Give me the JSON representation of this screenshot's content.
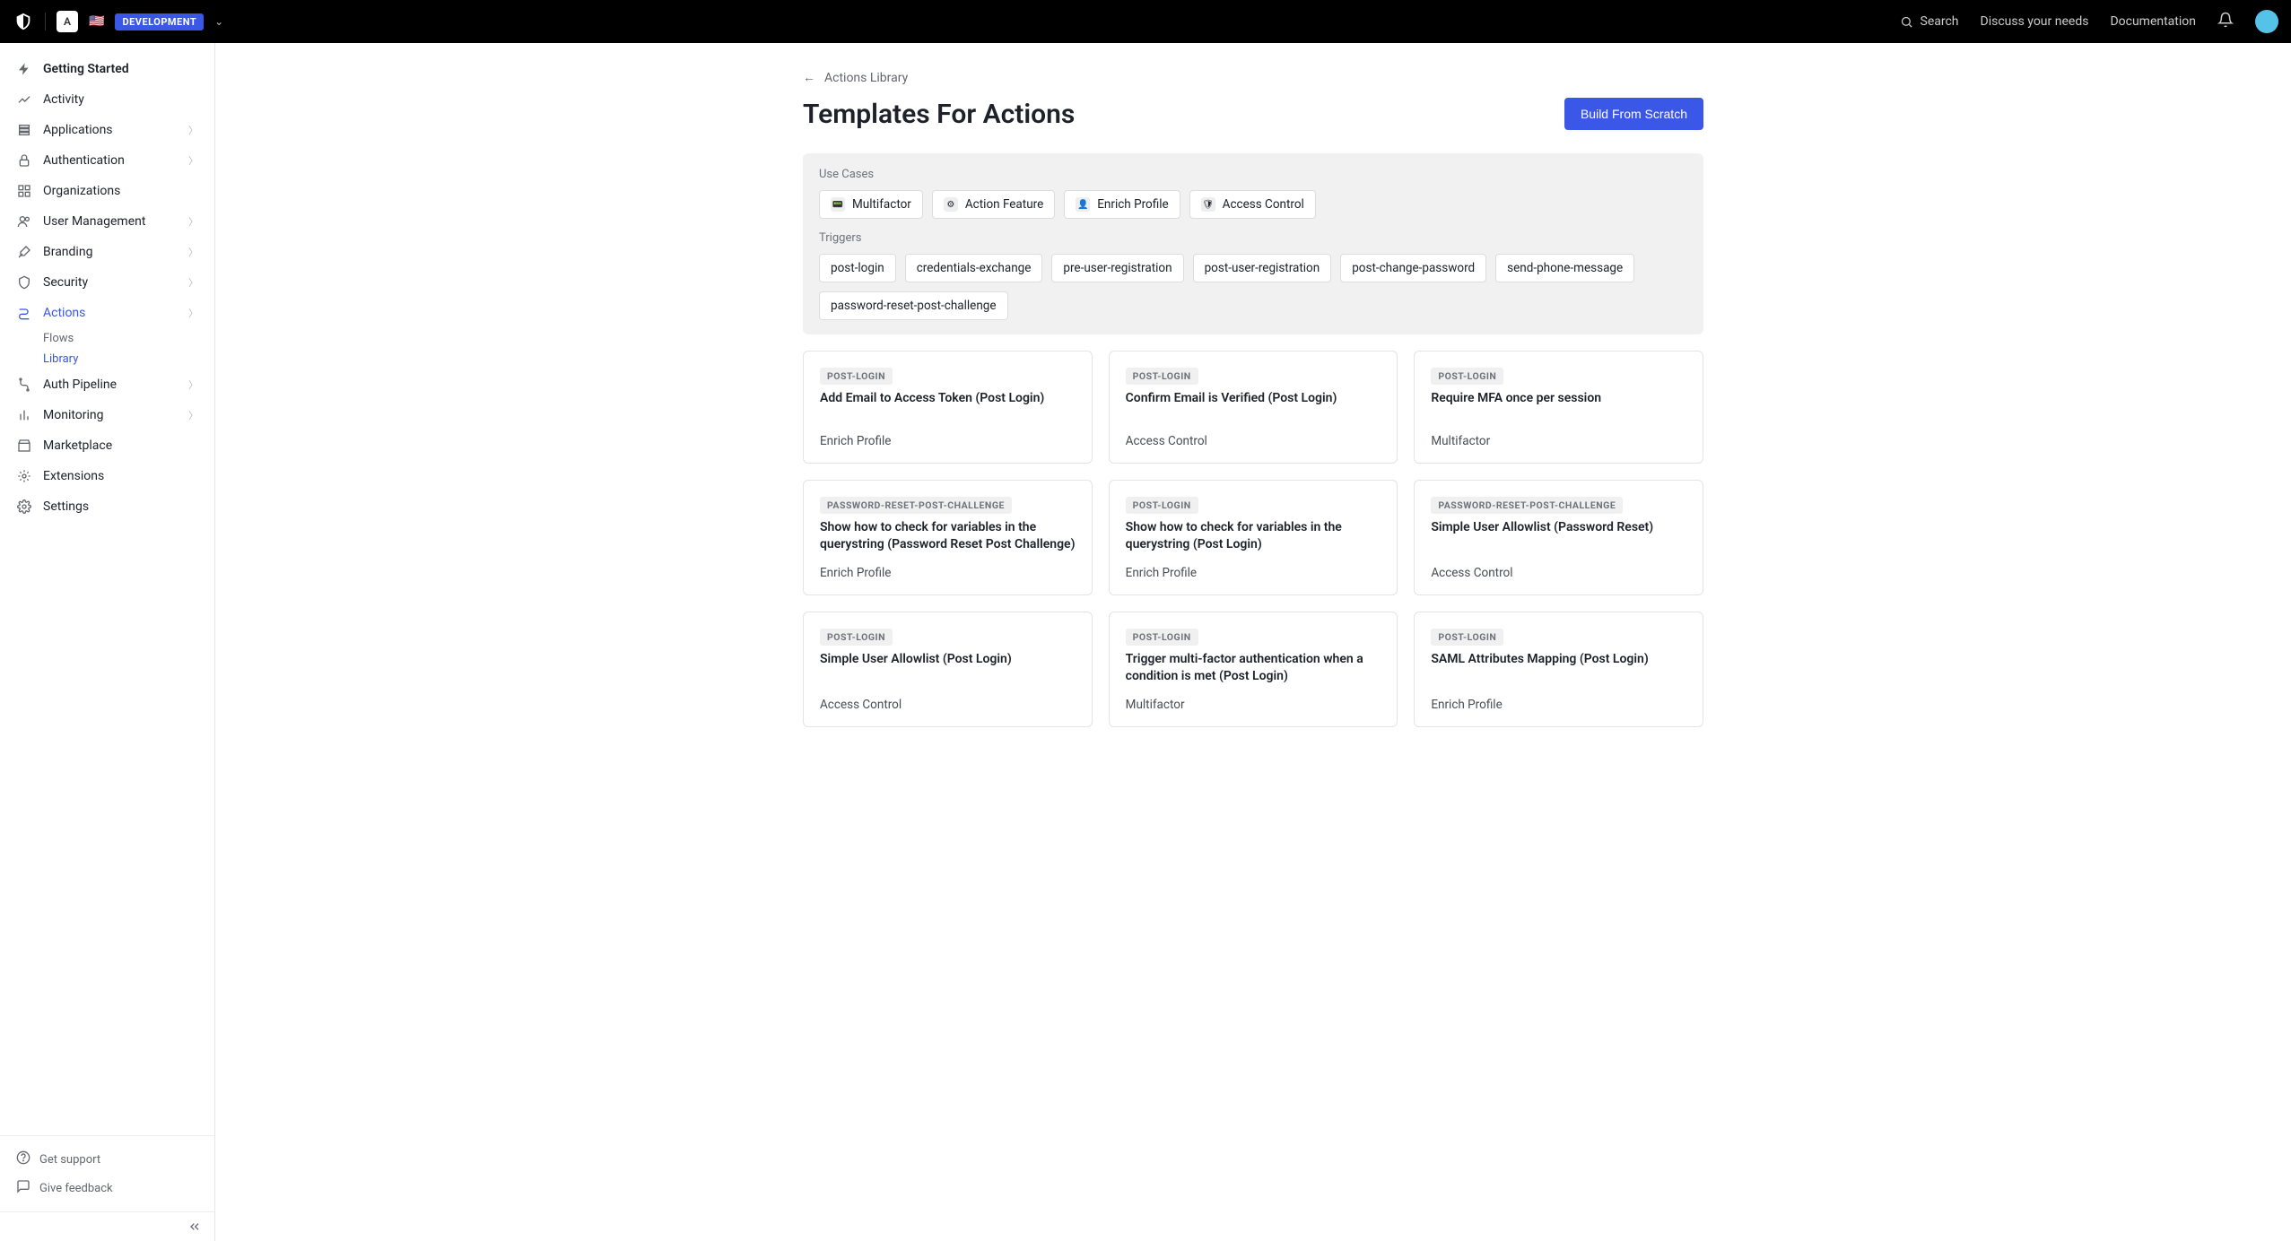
{
  "header": {
    "tenant_letter": "A",
    "flag": "🇺🇸",
    "env_badge": "DEVELOPMENT",
    "search_label": "Search",
    "links": [
      "Discuss your needs",
      "Documentation"
    ]
  },
  "sidebar": {
    "items": [
      {
        "icon": "bolt",
        "label": "Getting Started",
        "bold": true
      },
      {
        "icon": "chart",
        "label": "Activity"
      },
      {
        "icon": "stack",
        "label": "Applications",
        "chev": true
      },
      {
        "icon": "lock",
        "label": "Authentication",
        "chev": true
      },
      {
        "icon": "org",
        "label": "Organizations"
      },
      {
        "icon": "users",
        "label": "User Management",
        "chev": true
      },
      {
        "icon": "brush",
        "label": "Branding",
        "chev": true
      },
      {
        "icon": "shield",
        "label": "Security",
        "chev": true
      },
      {
        "icon": "flow",
        "label": "Actions",
        "chev": true,
        "active": true
      },
      {
        "icon": "pipe",
        "label": "Auth Pipeline",
        "chev": true
      },
      {
        "icon": "bars",
        "label": "Monitoring",
        "chev": true
      },
      {
        "icon": "market",
        "label": "Marketplace"
      },
      {
        "icon": "ext",
        "label": "Extensions"
      },
      {
        "icon": "gear",
        "label": "Settings"
      }
    ],
    "actions_sub": [
      {
        "label": "Flows"
      },
      {
        "label": "Library",
        "active": true
      }
    ],
    "help": [
      {
        "icon": "help",
        "label": "Get support"
      },
      {
        "icon": "feedback",
        "label": "Give feedback"
      }
    ]
  },
  "main": {
    "back_label": "Actions Library",
    "title": "Templates For Actions",
    "primary_button": "Build From Scratch",
    "filters": {
      "use_cases_label": "Use Cases",
      "triggers_label": "Triggers",
      "use_cases": [
        "Multifactor",
        "Action Feature",
        "Enrich Profile",
        "Access Control"
      ],
      "triggers": [
        "post-login",
        "credentials-exchange",
        "pre-user-registration",
        "post-user-registration",
        "post-change-password",
        "send-phone-message",
        "password-reset-post-challenge"
      ]
    },
    "templates": [
      {
        "trigger": "POST-LOGIN",
        "title": "Add Email to Access Token (Post Login)",
        "category": "Enrich Profile"
      },
      {
        "trigger": "POST-LOGIN",
        "title": "Confirm Email is Verified (Post Login)",
        "category": "Access Control"
      },
      {
        "trigger": "POST-LOGIN",
        "title": "Require MFA once per session",
        "category": "Multifactor"
      },
      {
        "trigger": "PASSWORD-RESET-POST-CHALLENGE",
        "title": "Show how to check for variables in the querystring (Password Reset Post Challenge)",
        "category": "Enrich Profile"
      },
      {
        "trigger": "POST-LOGIN",
        "title": "Show how to check for variables in the querystring (Post Login)",
        "category": "Enrich Profile"
      },
      {
        "trigger": "PASSWORD-RESET-POST-CHALLENGE",
        "title": "Simple User Allowlist (Password Reset)",
        "category": "Access Control"
      },
      {
        "trigger": "POST-LOGIN",
        "title": "Simple User Allowlist (Post Login)",
        "category": "Access Control"
      },
      {
        "trigger": "POST-LOGIN",
        "title": "Trigger multi-factor authentication when a condition is met (Post Login)",
        "category": "Multifactor"
      },
      {
        "trigger": "POST-LOGIN",
        "title": "SAML Attributes Mapping (Post Login)",
        "category": "Enrich Profile"
      }
    ]
  }
}
